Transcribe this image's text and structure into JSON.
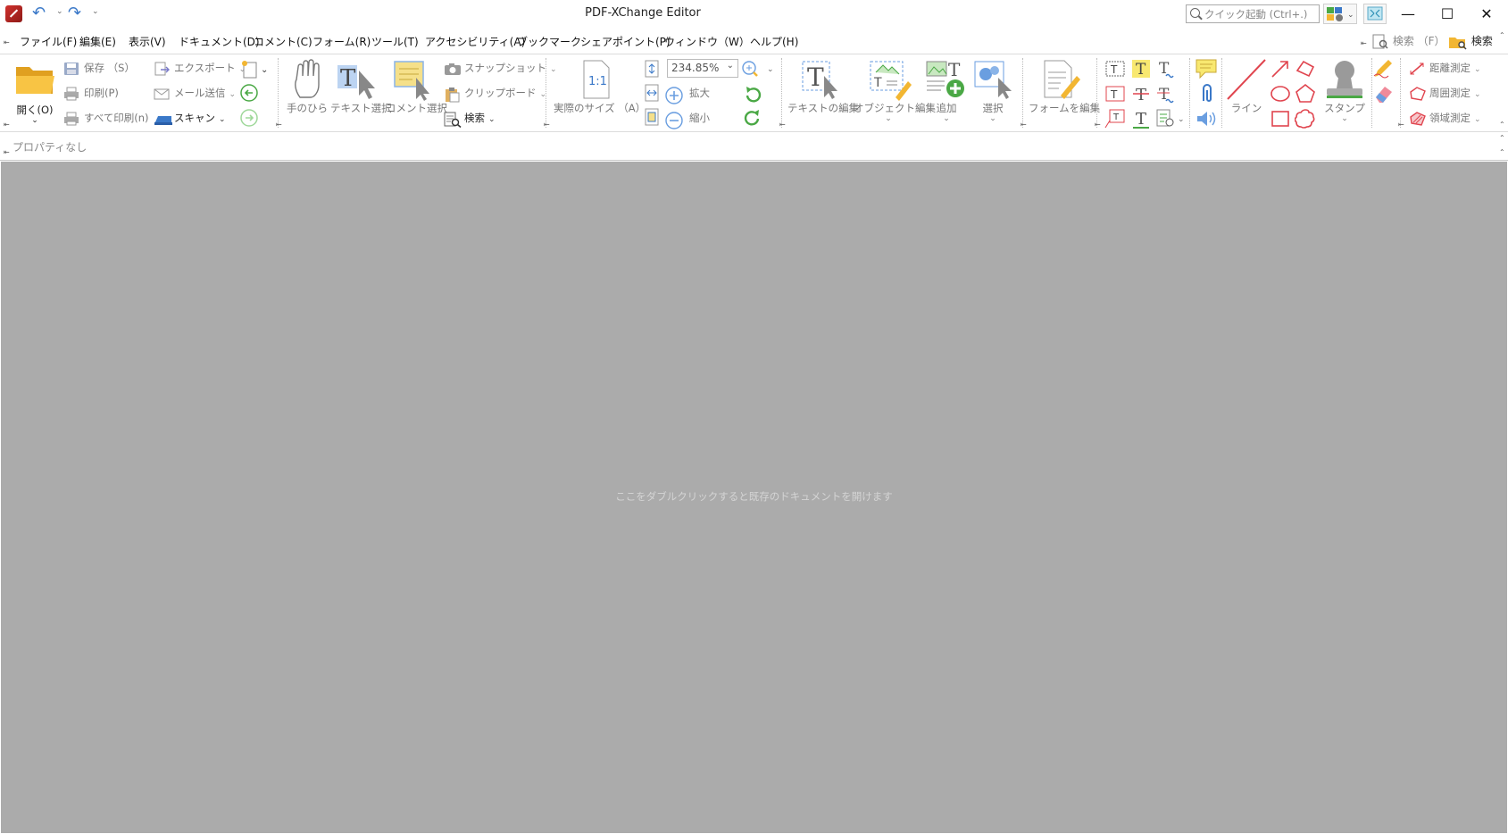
{
  "window": {
    "title": "PDF-XChange Editor",
    "quick_launch_placeholder": "クイック起動 (Ctrl+.)",
    "controls": {
      "minimize": "—",
      "maximize": "☐",
      "close": "✕"
    }
  },
  "menu": {
    "items": [
      "ファイル(F)",
      "編集(E)",
      "表示(V)",
      "ドキュメント(D)",
      "コメント(C)",
      "フォーム(R)",
      "ツール(T)",
      "アクセシビリティ(A)",
      "ブックマーク",
      "シェアポイント(P)",
      "ウィンドウ（W）",
      "ヘルプ(H)"
    ],
    "search_f": "検索 （F）",
    "search": "検索"
  },
  "ribbon": {
    "open": "開く(O)",
    "save": "保存 （S）",
    "print": "印刷(P)",
    "print_all": "すべて印刷(n)",
    "export": "エクスポート",
    "mail": "メール送信",
    "scan": "スキャン",
    "hand": "手のひら",
    "text_select": "テキスト選択",
    "comment_select": "コメント選択",
    "snapshot": "スナップショット",
    "clipboard": "クリップボード",
    "find": "検索",
    "actual_size": "実際のサイズ （A）",
    "zoom_value": "234.85%",
    "zoom_in": "拡大",
    "zoom_out": "縮小",
    "edit_text": "テキストの編集",
    "edit_object": "オブジェクト編集",
    "add": "追加",
    "select": "選択",
    "edit_form": "フォームを編集",
    "line": "ライン",
    "stamp": "スタンプ",
    "distance": "距離測定",
    "perimeter": "周囲測定",
    "area": "領域測定"
  },
  "properties": {
    "label": "プロパティなし"
  },
  "workspace": {
    "hint": "ここをダブルクリックすると既存のドキュメントを開けます"
  },
  "colors": {
    "workspace_bg": "#ababab",
    "accent_blue": "#3a78c8",
    "markup_red": "#e0444e",
    "folder_yellow": "#f2b632"
  }
}
